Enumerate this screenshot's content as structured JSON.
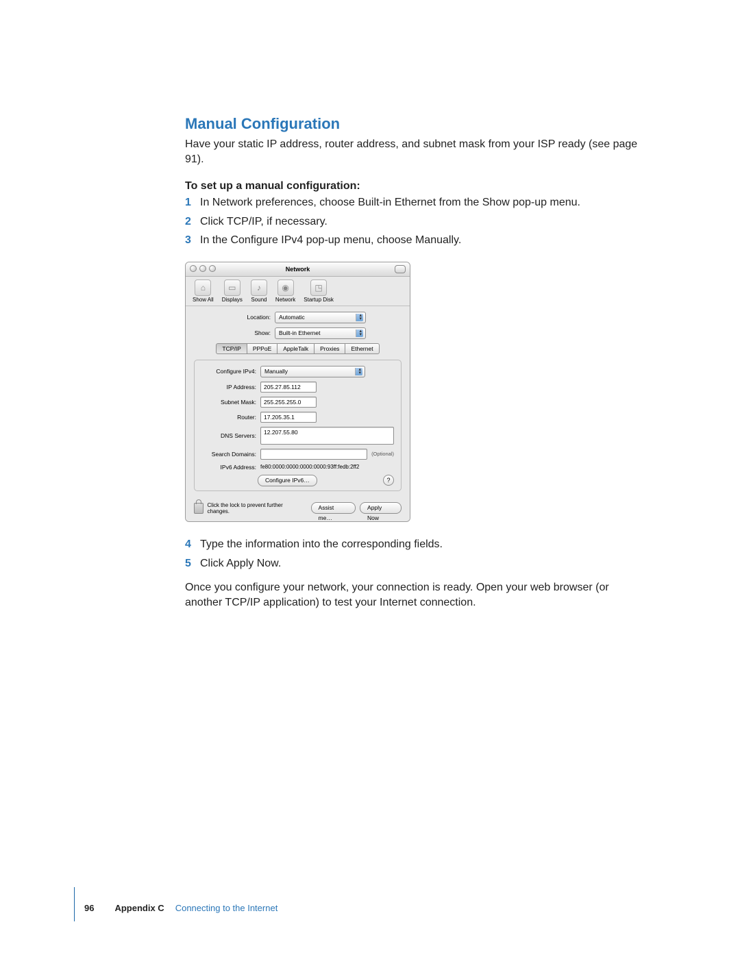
{
  "heading": "Manual Configuration",
  "intro": "Have your static IP address, router address, and subnet mask from your ISP ready (see page 91).",
  "subheading": "To set up a manual configuration:",
  "steps_a": [
    "In Network preferences, choose Built-in Ethernet from the Show pop-up menu.",
    "Click TCP/IP, if necessary.",
    "In the Configure IPv4 pop-up menu, choose Manually."
  ],
  "steps_b": [
    "Type the information into the corresponding fields.",
    "Click Apply Now."
  ],
  "after_text": "Once you configure your network, your connection is ready. Open your web browser (or another TCP/IP application) to test your Internet connection.",
  "footer": {
    "page": "96",
    "appendix": "Appendix C",
    "title": "Connecting to the Internet"
  },
  "window": {
    "title": "Network",
    "toolbar": {
      "show_all": "Show All",
      "displays": "Displays",
      "sound": "Sound",
      "network": "Network",
      "startup_disk": "Startup Disk"
    },
    "labels": {
      "location": "Location:",
      "show": "Show:",
      "configure_ipv4": "Configure IPv4:",
      "ip_address": "IP Address:",
      "subnet_mask": "Subnet Mask:",
      "router": "Router:",
      "dns_servers": "DNS Servers:",
      "search_domains": "Search Domains:",
      "ipv6_address": "IPv6 Address:",
      "optional": "(Optional)"
    },
    "values": {
      "location": "Automatic",
      "show": "Built-in Ethernet",
      "configure_ipv4": "Manually",
      "ip_address": "205.27.85.112",
      "subnet_mask": "255.255.255.0",
      "router": "17.205.35.1",
      "dns_servers": "12.207.55.80",
      "search_domains": "",
      "ipv6_address": "fe80:0000:0000:0000:0000:93ff:fedb:2ff2"
    },
    "tabs": [
      "TCP/IP",
      "PPPoE",
      "AppleTalk",
      "Proxies",
      "Ethernet"
    ],
    "buttons": {
      "configure_ipv6": "Configure IPv6…",
      "help": "?",
      "assist_me": "Assist me…",
      "apply_now": "Apply Now"
    },
    "lock_text": "Click the lock to prevent further changes."
  }
}
